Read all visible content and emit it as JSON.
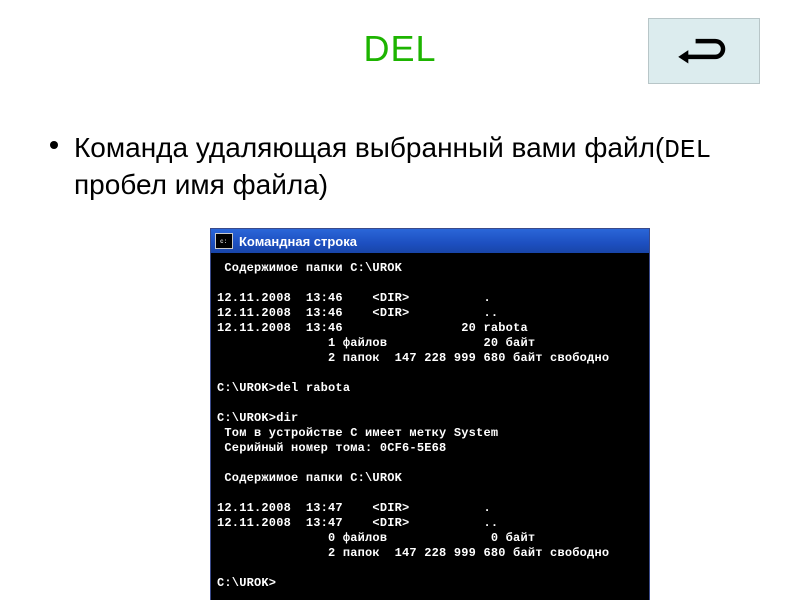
{
  "title": "DEL",
  "bullet_pre": "Команда удаляющая выбранный вами файл(",
  "bullet_mono": "DEL",
  "bullet_post": " пробел имя файла)",
  "back_icon_name": "u-turn-back-icon",
  "cmd": {
    "title": "Командная строка",
    "lines": " Содержимое папки C:\\UROK\n\n12.11.2008  13:46    <DIR>          .\n12.11.2008  13:46    <DIR>          ..\n12.11.2008  13:46                20 rabota\n               1 файлов             20 байт\n               2 папок  147 228 999 680 байт свободно\n\nC:\\UROK>del rabota\n\nC:\\UROK>dir\n Том в устройстве C имеет метку System\n Серийный номер тома: 0CF6-5E68\n\n Содержимое папки C:\\UROK\n\n12.11.2008  13:47    <DIR>          .\n12.11.2008  13:47    <DIR>          ..\n               0 файлов              0 байт\n               2 папок  147 228 999 680 байт свободно\n\nC:\\UROK>"
  }
}
